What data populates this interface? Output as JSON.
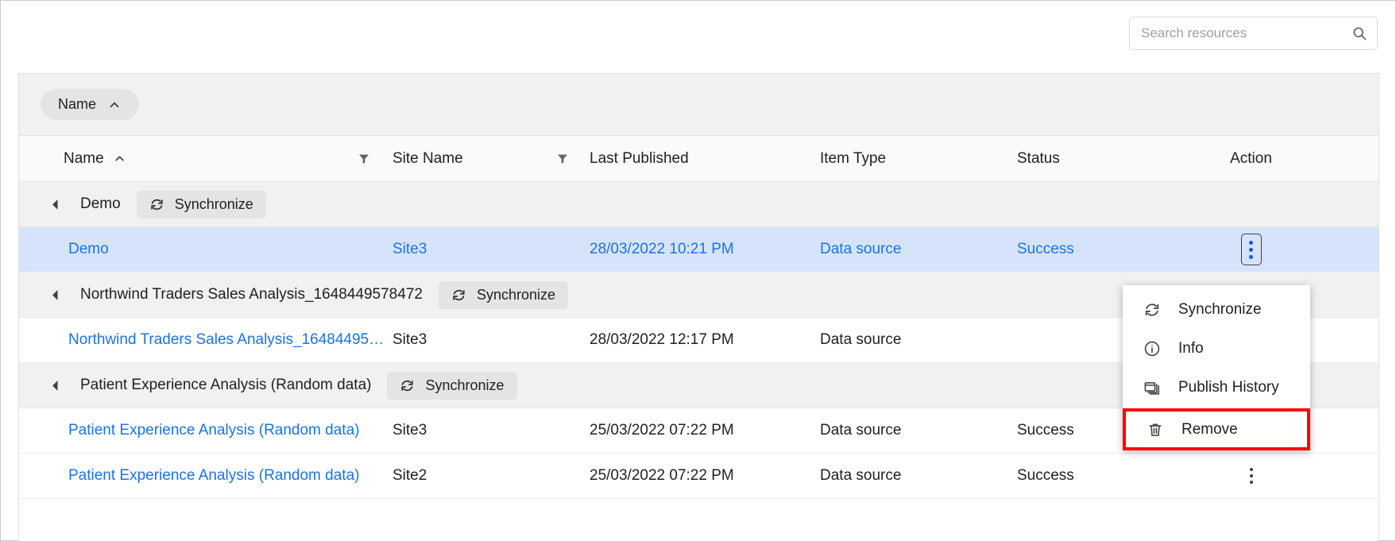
{
  "search": {
    "placeholder": "Search resources",
    "value": "",
    "icon": "search-icon"
  },
  "groupby": {
    "chip_label": "Name",
    "chip_icon": "chevron-up-icon"
  },
  "columns": [
    {
      "label": "Name",
      "sort": "ascending",
      "has_filter": true
    },
    {
      "label": "Site Name",
      "has_filter": true
    },
    {
      "label": "Last Published",
      "has_filter": false
    },
    {
      "label": "Item Type",
      "has_filter": false
    },
    {
      "label": "Status",
      "has_filter": false
    },
    {
      "label": "Action",
      "has_filter": false
    }
  ],
  "sync_button_label": "Synchronize",
  "groups": [
    {
      "title": "Demo",
      "rows": [
        {
          "name": "Demo",
          "site": "Site3",
          "published": "28/03/2022 10:21 PM",
          "type": "Data source",
          "status": "Success",
          "selected": true
        }
      ]
    },
    {
      "title": "Northwind Traders Sales Analysis_1648449578472",
      "rows": [
        {
          "name": "Northwind Traders Sales Analysis_16484495…",
          "site": "Site3",
          "published": "28/03/2022 12:17 PM",
          "type": "Data source",
          "status": "",
          "selected": false
        }
      ]
    },
    {
      "title": "Patient Experience Analysis (Random data)",
      "rows": [
        {
          "name": "Patient Experience Analysis (Random data)",
          "site": "Site3",
          "published": "25/03/2022 07:22 PM",
          "type": "Data source",
          "status": "Success",
          "selected": false
        },
        {
          "name": "Patient Experience Analysis (Random data)",
          "site": "Site2",
          "published": "25/03/2022 07:22 PM",
          "type": "Data source",
          "status": "Success",
          "selected": false
        }
      ]
    }
  ],
  "context_menu": {
    "items": [
      {
        "label": "Synchronize",
        "icon": "refresh-icon",
        "highlighted": false
      },
      {
        "label": "Info",
        "icon": "info-circle-icon",
        "highlighted": false
      },
      {
        "label": "Publish History",
        "icon": "windows-stack-icon",
        "highlighted": false
      },
      {
        "label": "Remove",
        "icon": "trash-icon",
        "highlighted": true
      }
    ],
    "highlight_color": "#ff0000"
  },
  "colors": {
    "link": "#1a73e8",
    "selected_row": "#d6e4fb",
    "group_bg": "#f1f1f1",
    "header_bg": "#fafafa"
  }
}
